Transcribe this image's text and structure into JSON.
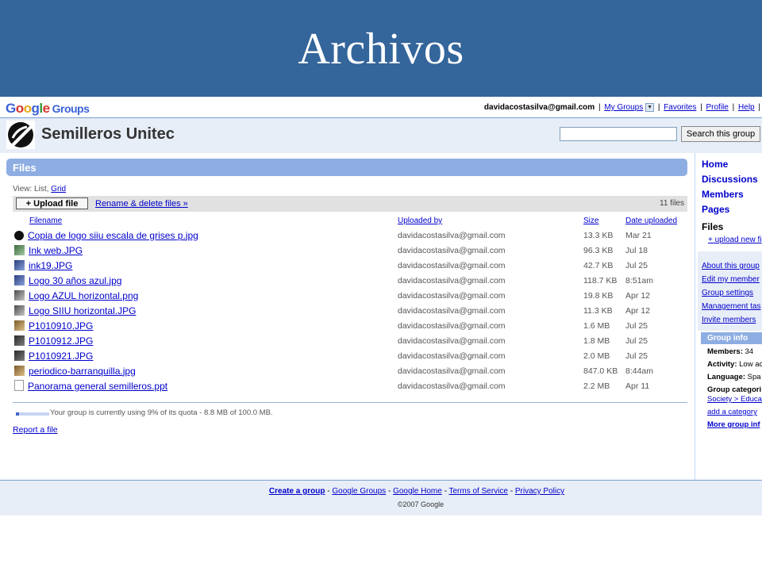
{
  "slide": {
    "title": "Archivos"
  },
  "header": {
    "logo_text": "Google",
    "logo_product": "Groups",
    "user_email": "davidacostasilva@gmail.com",
    "nav": [
      "My Groups",
      "Favorites",
      "Profile",
      "Help"
    ]
  },
  "group": {
    "name": "Semilleros Unitec",
    "search_button": "Search this group",
    "search_value": ""
  },
  "files_page": {
    "title": "Files",
    "view_label": "View: List,",
    "view_grid": "Grid",
    "upload_button": "+ Upload file",
    "rename_link": "Rename & delete files »",
    "count": "11 files",
    "columns": [
      "Filename",
      "Uploaded by",
      "Size",
      "Date uploaded"
    ],
    "rows": [
      {
        "icon": "logo-image-icon",
        "name": "Copia de logo siiu escala de grises p.jpg",
        "by": "davidacostasilva@gmail.com",
        "size": "13.3 KB",
        "date": "Mar 21"
      },
      {
        "icon": "image-file-icon",
        "name": "Ink web.JPG",
        "by": "davidacostasilva@gmail.com",
        "size": "96.3 KB",
        "date": "Jul 18"
      },
      {
        "icon": "image-file-icon",
        "name": "ink19.JPG",
        "by": "davidacostasilva@gmail.com",
        "size": "42.7 KB",
        "date": "Jul 25"
      },
      {
        "icon": "image-file-icon",
        "name": "Logo 30 años azul.jpg",
        "by": "davidacostasilva@gmail.com",
        "size": "118.7 KB",
        "date": "8:51am"
      },
      {
        "icon": "image-file-icon",
        "name": "Logo AZUL horizontal.png",
        "by": "davidacostasilva@gmail.com",
        "size": "19.8 KB",
        "date": "Apr 12"
      },
      {
        "icon": "image-file-icon",
        "name": "Logo SIIU horizontal.JPG",
        "by": "davidacostasilva@gmail.com",
        "size": "11.3 KB",
        "date": "Apr 12"
      },
      {
        "icon": "image-file-icon",
        "name": "P1010910.JPG",
        "by": "davidacostasilva@gmail.com",
        "size": "1.6 MB",
        "date": "Jul 25"
      },
      {
        "icon": "image-file-icon",
        "name": "P1010912.JPG",
        "by": "davidacostasilva@gmail.com",
        "size": "1.8 MB",
        "date": "Jul 25"
      },
      {
        "icon": "image-file-icon",
        "name": "P1010921.JPG",
        "by": "davidacostasilva@gmail.com",
        "size": "2.0 MB",
        "date": "Jul 25"
      },
      {
        "icon": "image-file-icon",
        "name": "periodico-barranquilla.jpg",
        "by": "davidacostasilva@gmail.com",
        "size": "847.0 KB",
        "date": "8:44am"
      },
      {
        "icon": "document-file-icon",
        "name": "Panorama general semilleros.ppt",
        "by": "davidacostasilva@gmail.com",
        "size": "2.2 MB",
        "date": "Apr 11"
      }
    ],
    "quota_text": "Your group is currently using 9% of its quota - 8.8 MB of 100.0 MB.",
    "quota_fraction": 0.09,
    "report_link": "Report a file"
  },
  "sidebar": {
    "nav": [
      "Home",
      "Discussions",
      "Members",
      "Pages"
    ],
    "current": "Files",
    "upload_link": "+ upload new fi",
    "manage_links": [
      "About this group",
      "Edit my member",
      "Group settings",
      "Management tas",
      "Invite members"
    ],
    "group_info": {
      "title": "Group info",
      "members_label": "Members:",
      "members_value": "34",
      "activity_label": "Activity:",
      "activity_value": "Low ac",
      "language_label": "Language:",
      "language_value": "Spa",
      "categories_label": "Group categori",
      "category_link": "Society > Educa",
      "add_category": "add a category",
      "more_info": "More group inf"
    }
  },
  "footer": {
    "links": [
      "Create a group",
      "Google Groups",
      "Google Home",
      "Terms of Service",
      "Privacy Policy"
    ],
    "copyright": "©2007 Google"
  }
}
